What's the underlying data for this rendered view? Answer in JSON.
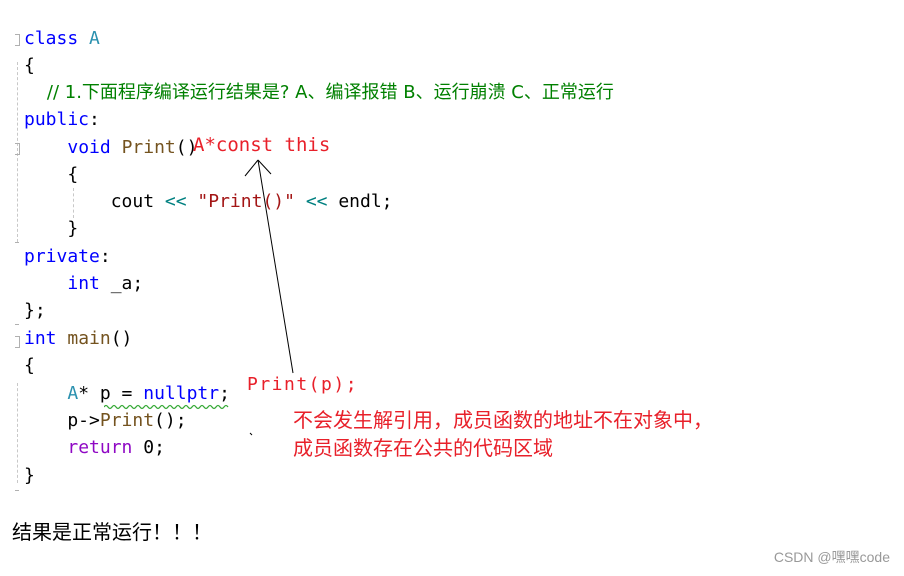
{
  "code": {
    "lines": [
      {
        "tokens": [
          {
            "t": "class",
            "c": "kw"
          },
          {
            "t": " "
          },
          {
            "t": "A",
            "c": "type"
          }
        ]
      },
      {
        "tokens": [
          {
            "t": "{"
          }
        ]
      },
      {
        "tokens": [
          {
            "t": "    // 1.下面程序编译运行结果是? A、编译报错 B、运行崩溃 C、正常运行",
            "c": "cm"
          }
        ]
      },
      {
        "tokens": [
          {
            "t": "public",
            "c": "kw"
          },
          {
            "t": ":"
          }
        ]
      },
      {
        "tokens": [
          {
            "t": "    "
          },
          {
            "t": "void",
            "c": "kw"
          },
          {
            "t": " "
          },
          {
            "t": "Print",
            "c": "fn"
          },
          {
            "t": "()"
          }
        ]
      },
      {
        "tokens": [
          {
            "t": "    {"
          }
        ]
      },
      {
        "tokens": [
          {
            "t": "        cout "
          },
          {
            "t": "<<",
            "c": "op"
          },
          {
            "t": " "
          },
          {
            "t": "\"Print()\"",
            "c": "str"
          },
          {
            "t": " "
          },
          {
            "t": "<<",
            "c": "op"
          },
          {
            "t": " endl;"
          }
        ]
      },
      {
        "tokens": [
          {
            "t": "    }"
          }
        ]
      },
      {
        "tokens": [
          {
            "t": "private",
            "c": "kw"
          },
          {
            "t": ":"
          }
        ]
      },
      {
        "tokens": [
          {
            "t": "    "
          },
          {
            "t": "int",
            "c": "kw"
          },
          {
            "t": " _a;"
          }
        ]
      },
      {
        "tokens": [
          {
            "t": "};"
          }
        ]
      },
      {
        "tokens": [
          {
            "t": "int",
            "c": "kw"
          },
          {
            "t": " "
          },
          {
            "t": "main",
            "c": "fn"
          },
          {
            "t": "()"
          }
        ]
      },
      {
        "tokens": [
          {
            "t": "{"
          }
        ]
      },
      {
        "tokens": [
          {
            "t": "    "
          },
          {
            "t": "A",
            "c": "type"
          },
          {
            "t": "* p = "
          },
          {
            "t": "nullptr",
            "c": "kw"
          },
          {
            "t": ";"
          }
        ]
      },
      {
        "tokens": [
          {
            "t": "    p->"
          },
          {
            "t": "Print",
            "c": "fn"
          },
          {
            "t": "();"
          }
        ]
      },
      {
        "tokens": [
          {
            "t": "    "
          },
          {
            "t": "return",
            "c": "ret"
          },
          {
            "t": " 0;"
          }
        ]
      },
      {
        "tokens": [
          {
            "t": "}"
          }
        ]
      }
    ]
  },
  "annotations": {
    "this_param": "A*const this",
    "call_form": "Print(p);",
    "explanation_line1": "不会发生解引用，成员函数的地址不在对象中，",
    "explanation_line2": "成员函数存在公共的代码区域"
  },
  "result_text": "结果是正常运行！！！",
  "watermark": "CSDN @嘿嘿code",
  "colors": {
    "keyword": "#0000ff",
    "type": "#2b91af",
    "function": "#74531f",
    "string": "#a31515",
    "comment": "#008000",
    "annotation": "#e8202a"
  }
}
